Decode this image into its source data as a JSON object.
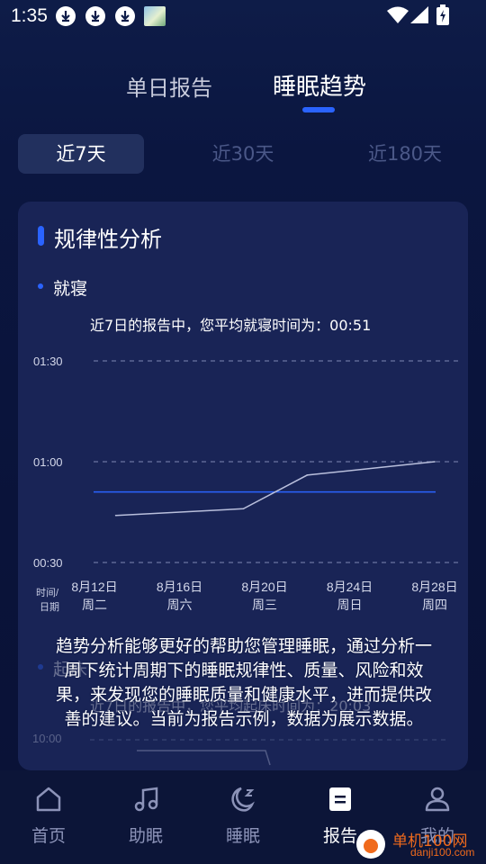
{
  "status_bar": {
    "time": "1:35",
    "icons": [
      "download-icon",
      "download-icon",
      "download-icon",
      "image-thumbnail-icon",
      "wifi-icon",
      "signal-icon",
      "battery-charging-icon"
    ]
  },
  "header": {
    "tabs": [
      {
        "label": "单日报告",
        "selected": false
      },
      {
        "label": "睡眠趋势",
        "selected": true
      }
    ]
  },
  "range_tabs": [
    {
      "label": "近7天",
      "selected": true
    },
    {
      "label": "近30天",
      "selected": false
    },
    {
      "label": "近180天",
      "selected": false
    }
  ],
  "card": {
    "title": "规律性分析",
    "section_label": "就寝",
    "summary": "近7日的报告中，您平均就寝时间为：00:51",
    "x_axis_caption_1": "时间/",
    "x_axis_caption_2": "日期",
    "faded_section_label": "起床",
    "faded_summary": "近7日的报告中，您平均起床时间为：20:03",
    "faded_axis_label": "10:00"
  },
  "chart_data": {
    "type": "line",
    "title": "",
    "y_ticks": [
      "01:30",
      "01:00",
      "00:30"
    ],
    "ylim_minutes_after_midnight": [
      30,
      90
    ],
    "x_ticks": [
      {
        "date": "8月12日",
        "weekday": "周二"
      },
      {
        "date": "8月16日",
        "weekday": "周六"
      },
      {
        "date": "8月20日",
        "weekday": "周三"
      },
      {
        "date": "8月24日",
        "weekday": "周日"
      },
      {
        "date": "8月28日",
        "weekday": "周四"
      }
    ],
    "series": [
      {
        "values": [
          {
            "x": "8月13日",
            "y": "00:44"
          },
          {
            "x": "8月19日",
            "y": "00:46"
          },
          {
            "x": "8月22日",
            "y": "00:56"
          },
          {
            "x": "8月28日",
            "y": "01:00"
          }
        ]
      }
    ],
    "average_line": "00:51",
    "grid": true
  },
  "overlay_message": "趋势分析能够更好的帮助您管理睡眠，通过分析一周下统计周期下的睡眠规律性、质量、风险和效果，来发现您的睡眠质量和健康水平，进而提供改善的建议。当前为报告示例，数据为展示数据。",
  "bottom_nav": [
    {
      "label": "首页",
      "icon": "home-icon",
      "active": false
    },
    {
      "label": "助眠",
      "icon": "music-note-icon",
      "active": false
    },
    {
      "label": "睡眠",
      "icon": "moon-icon",
      "active": false
    },
    {
      "label": "报告",
      "icon": "report-icon",
      "active": true
    },
    {
      "label": "我的",
      "icon": "profile-icon",
      "active": false
    }
  ],
  "watermark": {
    "text": "单机100网",
    "sub": "danji100.com"
  },
  "colors": {
    "accent": "#2a63ff",
    "background": "#0a133a",
    "card": "#192456",
    "watermark": "#f06a1c"
  }
}
